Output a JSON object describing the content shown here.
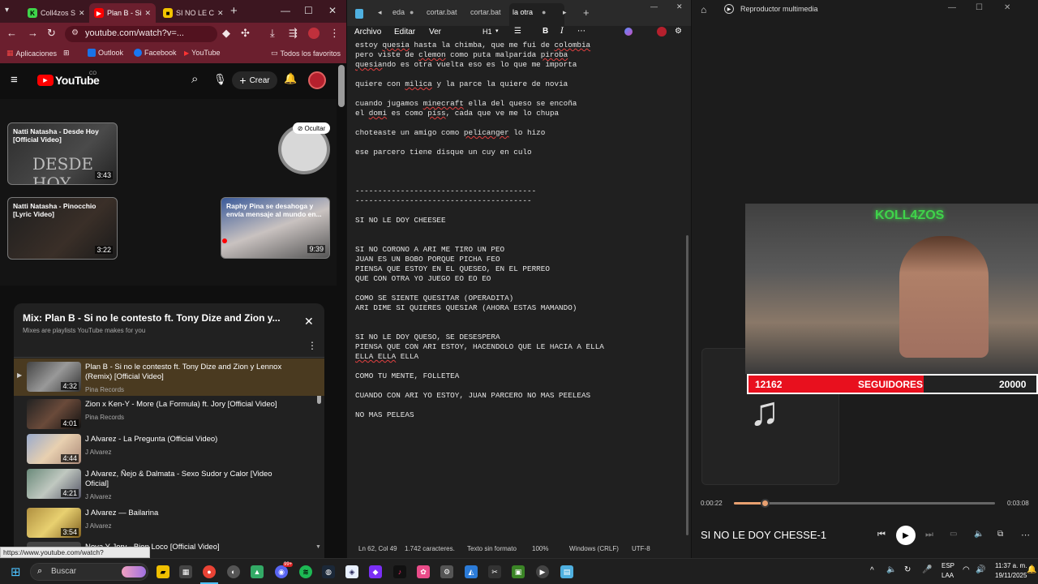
{
  "chrome": {
    "tabs": [
      {
        "label": "Coll4zos S"
      },
      {
        "label": "Plan B - Si"
      },
      {
        "label": "SI NO LE C"
      }
    ],
    "url": "youtube.com/watch?v=...",
    "bookmarks": {
      "apps": "Aplicaciones",
      "outlook": "Outlook",
      "facebook": "Facebook",
      "youtube": "YouTube",
      "all": "Todos los favoritos"
    },
    "status_url": "https://www.youtube.com/watch?v=scfKCVyXNLc"
  },
  "youtube": {
    "logo": "YouTube",
    "region": "CO",
    "create": "Crear",
    "hide": "Ocultar",
    "cards": [
      {
        "title": "Natti Natasha - Desde Hoy [Official Video]",
        "duration": "3:43",
        "overlay": "DESDE HOY"
      },
      {
        "title": "Natti Natasha - Pinocchio [Lyric Video]",
        "duration": "3:22"
      },
      {
        "title": "Raphy Pina se desahoga y envía mensaje al mundo en...",
        "duration": "9:39"
      }
    ],
    "mix": {
      "title": "Mix: Plan B - Si no le contesto ft. Tony Dize and Zion y...",
      "subtitle": "Mixes are playlists YouTube makes for you",
      "items": [
        {
          "title": "Plan B - Si no le contesto ft. Tony Dize and Zion y Lennox (Remix) [Official Video]",
          "channel": "Pina Records",
          "duration": "4:32"
        },
        {
          "title": "Zion x Ken-Y - More (La Formula) ft. Jory [Official Video]",
          "channel": "Pina Records",
          "duration": "4:01"
        },
        {
          "title": "J Alvarez - La Pregunta (Official Video)",
          "channel": "J Alvarez",
          "duration": "4:44"
        },
        {
          "title": "J Alvarez, Ñejo & Dalmata - Sexo Sudor y Calor [Video Oficial]",
          "channel": "J Alvarez",
          "duration": "4:21"
        },
        {
          "title": "J Alvarez — Bailarina",
          "channel": "J Alvarez",
          "duration": "3:54"
        },
        {
          "title": "Nova Y Jory - Bien Loco [Official Video]",
          "channel": "",
          "duration": ""
        }
      ]
    }
  },
  "notepad": {
    "tabs": [
      "eda",
      "cortar.bat",
      "cortar.bat",
      "la otra"
    ],
    "menu": {
      "file": "Archivo",
      "edit": "Editar",
      "view": "Ver",
      "heading": "H1"
    },
    "status": {
      "pos": "Ln 62, Col 49",
      "chars": "1.742 caracteres.",
      "format": "Texto sin formato",
      "zoom": "100%",
      "eol": "Windows (CRLF)",
      "enc": "UTF-8"
    },
    "lines": [
      "estoy quesia hasta la chimba, que me fui de colombia",
      "pero viste de clemon como puta malparida piroba",
      "quesiando es otra vuelta eso es lo que me importa",
      "",
      "quiere con milica y la parce la quiere de novia",
      "",
      "cuando jugamos minecraft ella del queso se encoña",
      "el domi es como piss, cada que ve me lo chupa",
      "",
      "choteaste un amigo como pelicanger lo hizo",
      "",
      "ese parcero tiene disque un cuy en culo",
      "",
      "",
      "",
      "----------------------------------------",
      "---------------------------------------",
      "",
      "SI NO LE DOY CHEESEE",
      "",
      "",
      "SI NO CORONO A ARI ME TIRO UN PEO",
      "JUAN ES UN BOBO PORQUE PICHA FEO",
      "PIENSA QUE ESTOY EN EL QUESEO, EN EL PERREO",
      "QUE CON OTRA YO JUEGO EO EO EO",
      "",
      "COMO SE SIENTE QUESITAR (OPERADITA)",
      "ARI DIME SI QUIERES QUESIAR (AHORA ESTAS MAMANDO)",
      "",
      "",
      "SI NO LE DOY QUESO, SE DESESPERA",
      "PIENSA QUE CON ARI ESTOY, HACENDOLO QUE LE HACIA A ELLA",
      "ELLA ELLA ELLA",
      "",
      "COMO TU MENTE, FOLLETEA",
      "",
      "CUANDO CON ARI YO ESTOY, JUAN PARCERO NO MAS PEELEAS",
      "",
      "NO MAS PELEAS"
    ]
  },
  "media": {
    "app": "Reproductor multimedia",
    "followers": {
      "current": "12162",
      "label": "SEGUIDORES",
      "goal": "20000",
      "fraction": 0.608
    },
    "stream_logo": "KOLL4ZOS",
    "time_elapsed": "0:00:22",
    "time_total": "0:03:08",
    "progress": 0.117,
    "track": "SI NO LE DOY CHESSE-1"
  },
  "taskbar": {
    "search": "Buscar",
    "lang": "ESP",
    "layout": "LAA",
    "time": "11:37 a. m.",
    "date": "19/11/2025",
    "discord_badge": "99+"
  }
}
